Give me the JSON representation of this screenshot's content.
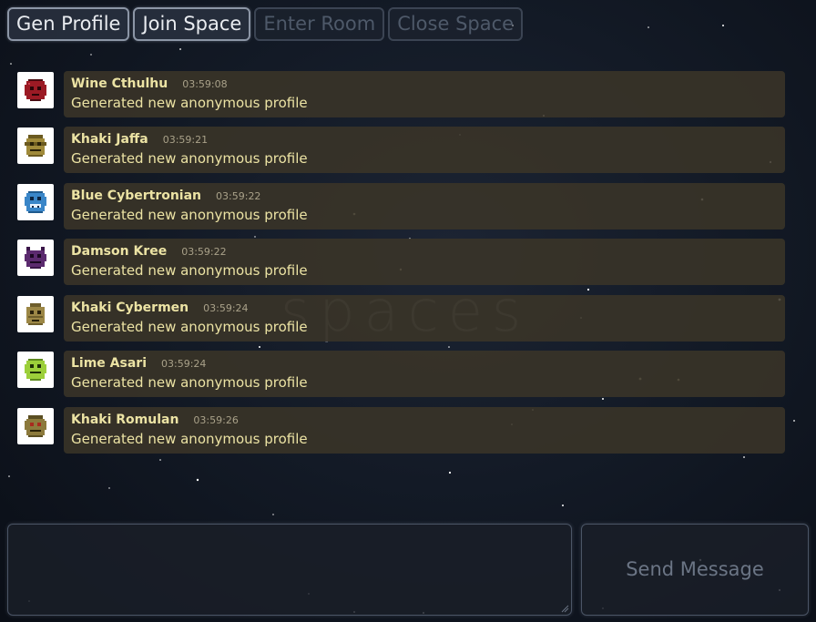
{
  "toolbar": {
    "gen_profile_label": "Gen Profile",
    "join_space_label": "Join Space",
    "enter_room_label": "Enter Room",
    "close_space_label": "Close Space"
  },
  "watermark": "spaces",
  "messages": [
    {
      "name": "Wine Cthulhu",
      "time": "03:59:08",
      "text": "Generated new anonymous profile",
      "avatar_icon": "red-alien-avatar-icon",
      "avatar_color": "#9b1a24"
    },
    {
      "name": "Khaki Jaffa",
      "time": "03:59:21",
      "text": "Generated new anonymous profile",
      "avatar_icon": "khaki-alien-avatar-icon",
      "avatar_color": "#a08a3a"
    },
    {
      "name": "Blue Cybertronian",
      "time": "03:59:22",
      "text": "Generated new anonymous profile",
      "avatar_icon": "blue-alien-avatar-icon",
      "avatar_color": "#3a86c8"
    },
    {
      "name": "Damson Kree",
      "time": "03:59:22",
      "text": "Generated new anonymous profile",
      "avatar_icon": "purple-alien-avatar-icon",
      "avatar_color": "#5b2a6e"
    },
    {
      "name": "Khaki Cybermen",
      "time": "03:59:24",
      "text": "Generated new anonymous profile",
      "avatar_icon": "khaki-alien-avatar-icon",
      "avatar_color": "#9c8746"
    },
    {
      "name": "Lime Asari",
      "time": "03:59:24",
      "text": "Generated new anonymous profile",
      "avatar_icon": "lime-alien-avatar-icon",
      "avatar_color": "#9ccf3a"
    },
    {
      "name": "Khaki Romulan",
      "time": "03:59:26",
      "text": "Generated new anonymous profile",
      "avatar_icon": "khaki-alien-avatar-icon",
      "avatar_color": "#8c7a3c"
    }
  ],
  "composer": {
    "value": "",
    "placeholder": ""
  },
  "send_label": "Send Message"
}
